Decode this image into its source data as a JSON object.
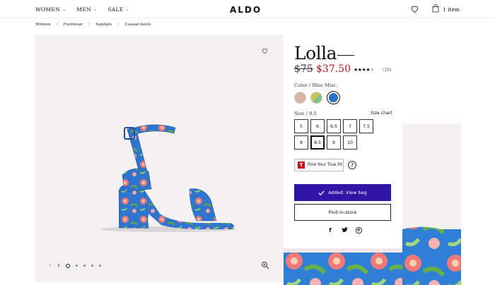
{
  "header": {
    "nav": [
      {
        "label": "WOMEN"
      },
      {
        "label": "MEN"
      },
      {
        "label": "SALE"
      }
    ],
    "logo": "ALDO",
    "cart_label": "1 item"
  },
  "breadcrumb": [
    "Women",
    "Footwear",
    "Sandals",
    "Casual heels"
  ],
  "product": {
    "title": "Lolla",
    "old_price": "$75",
    "new_price": "$37.50",
    "rating": 4,
    "rating_max": 5,
    "review_count": "(29)",
    "color_prefix": "Color /",
    "color_value": "Blue Misc.",
    "size_prefix": "Size /",
    "size_value": "8.5",
    "size_chart_label": "Size chart",
    "sizes": [
      "5",
      "6",
      "6.5",
      "7",
      "7.5",
      "8",
      "8.5",
      "9",
      "10"
    ],
    "selected_size": "8.5",
    "true_fit_label": "Find Your True Fit",
    "true_fit_logo": "T",
    "help_label": "?",
    "added_label": "Added. View bag",
    "find_store_label": "Find in-store"
  },
  "swatches": [
    {
      "color": "#d8b5a4"
    },
    {
      "color": "#c7c954",
      "color2": "#7fc28a"
    },
    {
      "color": "#2a6fc9",
      "selected": true
    }
  ],
  "colors": {
    "accent_button": "#2f16a7",
    "sale_price": "#b01419",
    "image_bg": "#f3f1f2"
  },
  "carousel": {
    "slide_count": 5,
    "active_slide": 0
  }
}
